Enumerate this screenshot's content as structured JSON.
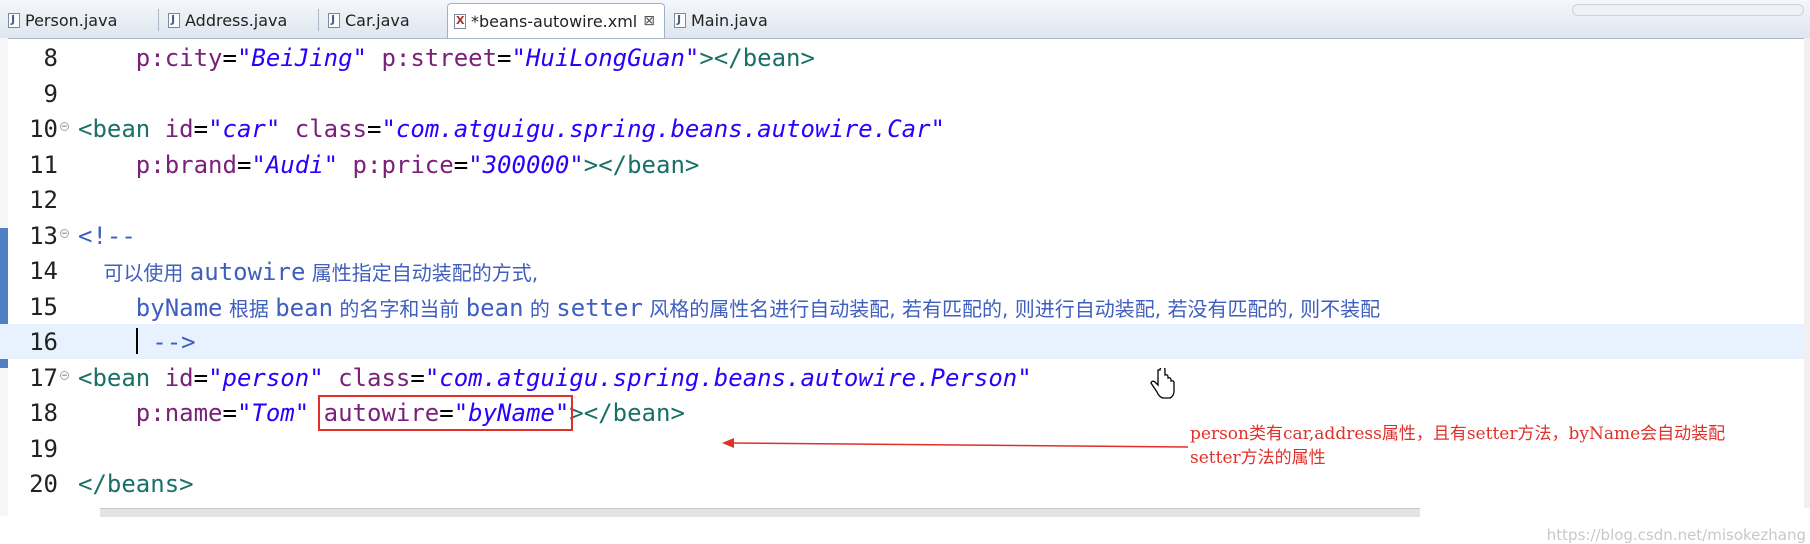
{
  "tabs": [
    {
      "label": "Person.java",
      "type": "java"
    },
    {
      "label": "Address.java",
      "type": "java"
    },
    {
      "label": "Car.java",
      "type": "java"
    },
    {
      "label": "*beans-autowire.xml",
      "type": "xml",
      "active": true
    },
    {
      "label": "Main.java",
      "type": "java"
    }
  ],
  "close_glyph": "⊠",
  "editor": {
    "current_line": 16,
    "lines": [
      {
        "n": "8",
        "segs": [
          [
            "    p:city",
            "attr"
          ],
          [
            "=",
            "eq"
          ],
          [
            "\"BeiJing\"",
            "val"
          ],
          [
            " p:street",
            "attr"
          ],
          [
            "=",
            "eq"
          ],
          [
            "\"HuiLongGuan\"",
            "val"
          ],
          [
            "></bean>",
            "tag"
          ]
        ]
      },
      {
        "n": "9",
        "segs": []
      },
      {
        "n": "10",
        "segs": [
          [
            "<bean",
            "tag"
          ],
          [
            " id",
            "attr"
          ],
          [
            "=",
            "eq"
          ],
          [
            "\"car\"",
            "val"
          ],
          [
            " class",
            "attr"
          ],
          [
            "=",
            "eq"
          ],
          [
            "\"com.atguigu.spring.beans.autowire.Car\"",
            "val"
          ]
        ]
      },
      {
        "n": "11",
        "segs": [
          [
            "    p:brand",
            "attr"
          ],
          [
            "=",
            "eq"
          ],
          [
            "\"Audi\"",
            "val"
          ],
          [
            " p:price",
            "attr"
          ],
          [
            "=",
            "eq"
          ],
          [
            "\"300000\"",
            "val"
          ],
          [
            "></bean>",
            "tag"
          ]
        ]
      },
      {
        "n": "12",
        "segs": []
      },
      {
        "n": "13",
        "segs": [
          [
            "<!--",
            "cmt"
          ]
        ]
      },
      {
        "n": "14",
        "segs": [
          [
            "    可以使用 ",
            "cmt cjk"
          ],
          [
            "autowire",
            "cmt"
          ],
          [
            " 属性指定自动装配的方式,",
            "cmt cjk"
          ]
        ]
      },
      {
        "n": "15",
        "segs": [
          [
            "    byName",
            "cmt"
          ],
          [
            " 根据 ",
            "cmt cjk"
          ],
          [
            "bean",
            "cmt"
          ],
          [
            " 的名字和当前 ",
            "cmt cjk"
          ],
          [
            "bean",
            "cmt"
          ],
          [
            " 的 ",
            "cmt cjk"
          ],
          [
            "setter",
            "cmt"
          ],
          [
            " 风格的属性名进行自动装配, 若有匹配的, 则进行自动装配, 若没有匹配的, 则不装配",
            "cmt cjk"
          ]
        ]
      },
      {
        "n": "16",
        "segs": [
          [
            "    ",
            ""
          ],
          [
            "|",
            "cursor"
          ],
          [
            " -->",
            "cmt"
          ]
        ]
      },
      {
        "n": "17",
        "segs": [
          [
            "<bean",
            "tag"
          ],
          [
            " id",
            "attr"
          ],
          [
            "=",
            "eq"
          ],
          [
            "\"person\"",
            "val"
          ],
          [
            " class",
            "attr"
          ],
          [
            "=",
            "eq"
          ],
          [
            "\"com.atguigu.spring.beans.autowire.Person\"",
            "val"
          ]
        ]
      },
      {
        "n": "18",
        "segs": [
          [
            "    p:name",
            "attr"
          ],
          [
            "=",
            "eq"
          ],
          [
            "\"Tom\"",
            "val"
          ],
          [
            " ",
            "eq"
          ],
          [
            "autowire",
            "attr"
          ],
          [
            "=",
            "eq"
          ],
          [
            "\"byName\"",
            "val"
          ],
          [
            "></bean>",
            "tag"
          ]
        ]
      },
      {
        "n": "19",
        "segs": []
      },
      {
        "n": "20",
        "segs": [
          [
            "</beans>",
            "tag"
          ]
        ]
      }
    ]
  },
  "annotation": {
    "line1": "person类有car,address属性，且有setter方法，byName会自动装配",
    "line2": "setter方法的属性"
  },
  "watermark": "https://blog.csdn.net/misokezhang",
  "colors": {
    "tag": "#1a7066",
    "attr": "#7a1f7a",
    "value": "#2a00ff",
    "comment": "#3f5fbf",
    "annotation": "#e0302a"
  }
}
